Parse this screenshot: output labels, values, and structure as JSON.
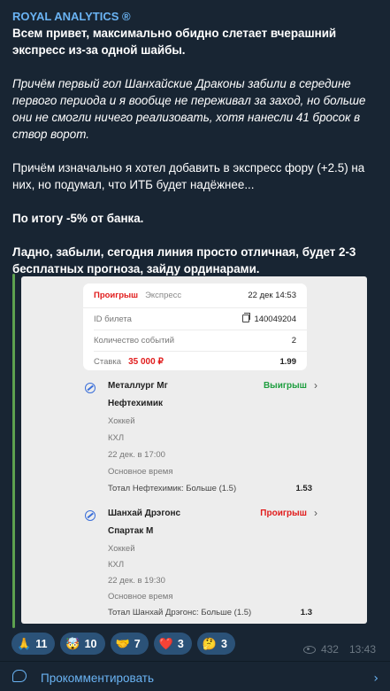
{
  "post": {
    "channel_name": "ROYAL ANALYTICS ®",
    "paragraph1": "Всем привет, максимально обидно слетает вчерашний экспресс из-за одной шайбы.",
    "paragraph2": "Причём первый гол Шанхайские Драконы забили в середине первого периода и я вообще не переживал за заход, но больше они не смогли ничего реализовать, хотя нанесли 41 бросок в створ ворот.",
    "paragraph3": "Причём изначально я хотел добавить в экспресс фору (+2.5) на них, но подумал, что ИТБ будет надёжнее...",
    "paragraph4": "По итогу -5% от банка.",
    "paragraph5": "Ладно, забыли, сегодня линия просто отличная, будет 2-3 бесплатных прогноза, зайду ординарами."
  },
  "bet_slip": {
    "status": "Проигрыш",
    "type": "Экспресс",
    "date": "22 дек 14:53",
    "ticket_label": "ID билета",
    "ticket_id": "140049204",
    "events_label": "Количество событий",
    "events_count": "2",
    "stake_label": "Ставка",
    "stake_amount": "35 000 ₽",
    "total_odds": "1.99",
    "events": [
      {
        "team1": "Металлург Мг",
        "team2": "Нефтехимик",
        "result": "Выигрыш",
        "sport": "Хоккей",
        "league": "КХЛ",
        "datetime": "22 дек. в 17:00",
        "period": "Основное время",
        "market": "Тотал Нефтехимик: Больше (1.5)",
        "odds": "1.53"
      },
      {
        "team1": "Шанхай Дрэгонс",
        "team2": "Спартак М",
        "result": "Проигрыш",
        "sport": "Хоккей",
        "league": "КХЛ",
        "datetime": "22 дек. в 19:30",
        "period": "Основное время",
        "market": "Тотал Шанхай Дрэгонс: Больше (1.5)",
        "odds": "1.3"
      }
    ]
  },
  "reactions": [
    {
      "emoji": "🙏",
      "count": "11"
    },
    {
      "emoji": "🤯",
      "count": "10"
    },
    {
      "emoji": "🤝",
      "count": "7"
    },
    {
      "emoji": "❤️",
      "count": "3"
    },
    {
      "emoji": "🤔",
      "count": "3"
    }
  ],
  "meta": {
    "views": "432",
    "time": "13:43"
  },
  "comments": {
    "label": "Прокомментировать"
  },
  "colors": {
    "background": "#182533",
    "accent": "#6ab3f3",
    "reaction_bg": "#2b5278",
    "quote_bar": "#5da14f",
    "win": "#1e9e3f",
    "lose": "#e11d1d"
  }
}
